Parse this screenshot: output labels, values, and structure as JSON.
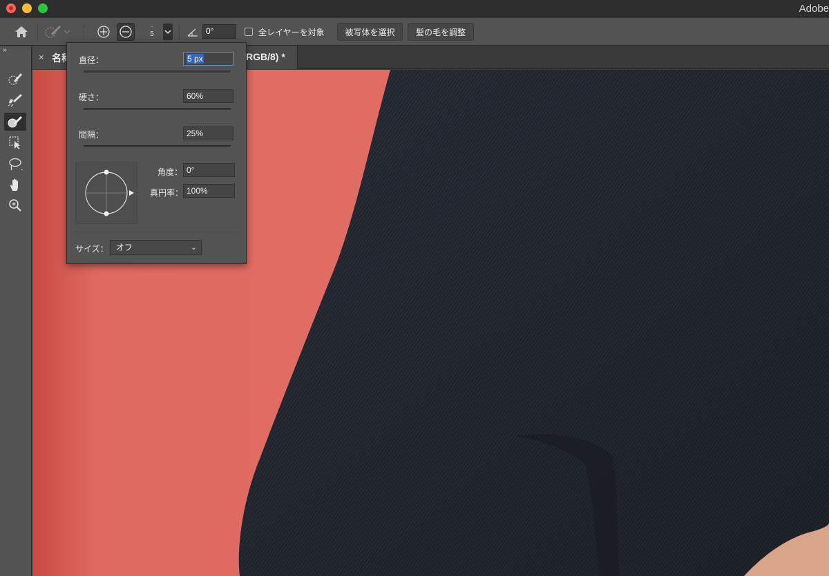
{
  "window": {
    "app_title": "Adobe"
  },
  "options_bar": {
    "brush_size_value": "5",
    "angle_value": "0°",
    "sample_all_layers_label": "全レイヤーを対象",
    "sample_all_layers_checked": false,
    "select_subject_label": "被写体を選択",
    "refine_hair_label": "髪の毛を調整"
  },
  "document_tab": {
    "title_prefix": "名称",
    "title_suffix": "RGB/8) *",
    "close_symbol": "×"
  },
  "brush_popup": {
    "diameter_label": "直径：",
    "diameter_value": "5 px",
    "diameter_fraction": 0.01,
    "hardness_label": "硬さ：",
    "hardness_value": "60%",
    "hardness_fraction": 0.6,
    "spacing_label": "間隔：",
    "spacing_value": "25%",
    "spacing_fraction": 0.1,
    "angle_label": "角度：",
    "angle_value": "0°",
    "roundness_label": "真円率：",
    "roundness_value": "100%",
    "size_label": "サイズ：",
    "size_option": "オフ"
  },
  "icons": {
    "home": "home-icon",
    "brush_preset": "quick-selection-brush-icon",
    "add_mode": "add-to-selection-icon",
    "subtract_mode": "subtract-from-selection-icon",
    "angle": "angle-icon"
  },
  "colors": {
    "ui_panel": "#535353",
    "canvas_mask_red": "#df6a62",
    "fabric_dark": "#22262f",
    "selection_blue": "#2e68c5"
  }
}
